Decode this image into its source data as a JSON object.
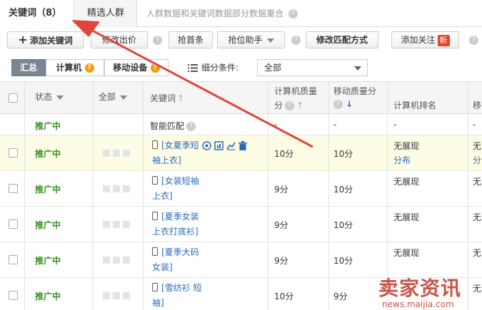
{
  "tabs": [
    {
      "label": "关键词（8）"
    },
    {
      "label": "精选人群"
    }
  ],
  "tab_info": "人群数据和关键词数据部分数据重合",
  "toolbar": {
    "add_keyword": "添加关键词",
    "modify_price": "修改出价",
    "grab_first": "抢首条",
    "rank_helper": "抢位助手",
    "modify_match": "修改匹配方式",
    "add_follow": "添加关注",
    "new_badge": "新"
  },
  "filter": {
    "summary": "汇总",
    "computer": "计算机",
    "mobile": "移动设备",
    "condition_label": "细分条件:",
    "condition_value": "全部"
  },
  "table": {
    "headers": {
      "status": "状态",
      "all": "全部",
      "keyword": "关键词",
      "pc_quality_1": "计算机质量",
      "pc_quality_2": "分",
      "mobile_quality": "移动质量分",
      "pc_rank": "计算机排名",
      "mobile_rank_cut": "移"
    },
    "smart_row": {
      "status": "推广中",
      "keyword": "智能匹配",
      "pc_quality": "-",
      "mobile_quality": "-",
      "pc_rank": "-",
      "mobile_rank": "-"
    },
    "rows": [
      {
        "status": "推广中",
        "kw1": "[女夏季短",
        "kw2": "袖上衣]",
        "pc_quality": "10分",
        "mobile_quality": "10分",
        "pc_rank": "无展现",
        "pc_rank_link": "分布",
        "mobile_rank": "无",
        "mobile_rank_link": "分"
      },
      {
        "status": "推广中",
        "kw1": "[女装短袖",
        "kw2": "上衣]",
        "pc_quality": "9分",
        "mobile_quality": "10分",
        "pc_rank": "无展现",
        "pc_rank_link": "",
        "mobile_rank": "无",
        "mobile_rank_link": ""
      },
      {
        "status": "推广中",
        "kw1": "[夏季女装",
        "kw2": "上衣打底衫]",
        "pc_quality": "9分",
        "mobile_quality": "10分",
        "pc_rank": "无展现",
        "pc_rank_link": "",
        "mobile_rank": "无",
        "mobile_rank_link": ""
      },
      {
        "status": "推广中",
        "kw1": "[夏季大码",
        "kw2": "女装]",
        "pc_quality": "9分",
        "mobile_quality": "10分",
        "pc_rank": "无展现",
        "pc_rank_link": "",
        "mobile_rank": "无",
        "mobile_rank_link": ""
      },
      {
        "status": "推广中",
        "kw1": "[雪纺衫 短",
        "kw2": "袖]",
        "pc_quality": "10分",
        "mobile_quality": "9分",
        "pc_rank": "",
        "pc_rank_link": "",
        "mobile_rank": "无",
        "mobile_rank_link": ""
      }
    ]
  },
  "watermark": {
    "title": "卖家资讯",
    "url": "news.maijia.com"
  },
  "colors": {
    "status_green": "#3a8f1f",
    "link_blue": "#2a6ab8",
    "arrow_red": "#e0453a",
    "new_red": "#e8402a"
  }
}
